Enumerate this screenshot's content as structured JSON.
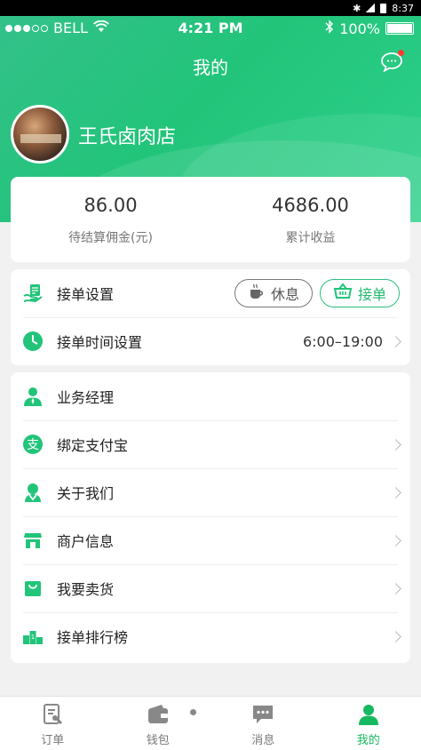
{
  "android_status": {
    "bluetooth_icon": "bluetooth-icon",
    "time": "8:37"
  },
  "ios_status": {
    "carrier": "BELL",
    "time": "4:21 PM",
    "battery": "100%"
  },
  "header": {
    "title": "我的",
    "shop_name": "王氏卤肉店"
  },
  "colors": {
    "accent": "#22c47a",
    "text": "#222222",
    "muted": "#777777",
    "badge": "#ff3b30"
  },
  "stats": [
    {
      "value": "86.00",
      "label": "待结算佣金(元)"
    },
    {
      "value": "4686.00",
      "label": "累计收益"
    }
  ],
  "settings": {
    "order_settings": {
      "label": "接单设置",
      "rest_label": "休息",
      "accept_label": "接单"
    },
    "order_time": {
      "label": "接单时间设置",
      "value": "6:00–19:00"
    }
  },
  "menu": [
    {
      "label": "业务经理",
      "icon": "manager-icon"
    },
    {
      "label": "绑定支付宝",
      "icon": "alipay-icon"
    },
    {
      "label": "关于我们",
      "icon": "about-icon"
    },
    {
      "label": "商户信息",
      "icon": "store-icon"
    },
    {
      "label": "我要卖货",
      "icon": "bag-icon"
    },
    {
      "label": "接单排行榜",
      "icon": "ranking-icon"
    }
  ],
  "tabs": [
    {
      "label": "订单",
      "icon": "orders-icon"
    },
    {
      "label": "钱包",
      "icon": "wallet-icon"
    },
    {
      "label": "消息",
      "icon": "message-icon"
    },
    {
      "label": "我的",
      "icon": "profile-icon"
    }
  ]
}
